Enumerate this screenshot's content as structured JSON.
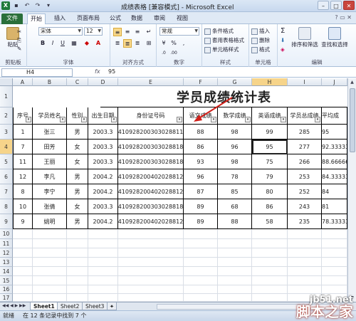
{
  "window": {
    "title": "成绩表格 [兼容模式] - Microsoft Excel"
  },
  "tabs": [
    "文件",
    "开始",
    "插入",
    "页面布局",
    "公式",
    "数据",
    "审阅",
    "视图"
  ],
  "ribbon": {
    "paste": "粘贴",
    "font_name": "宋体",
    "font_size": "12",
    "number_format": "常规",
    "bold": "B",
    "italic": "I",
    "underline": "U",
    "cond_format": "条件格式",
    "table_format": "套用表格格式",
    "cell_style": "单元格样式",
    "insert": "插入",
    "delete": "删除",
    "format": "格式",
    "sort_filter": "排序和筛选",
    "find_select": "查找和选择",
    "groups": {
      "clipboard": "剪贴板",
      "font": "字体",
      "align": "对齐方式",
      "number": "数字",
      "styles": "样式",
      "cells": "单元格",
      "editing": "编辑"
    }
  },
  "formula_bar": {
    "cell_ref": "H4",
    "fx": "fx",
    "value": "95"
  },
  "columns": [
    "A",
    "B",
    "C",
    "D",
    "E",
    "F",
    "G",
    "H",
    "I",
    "J"
  ],
  "rows": [
    "1",
    "2",
    "3",
    "4",
    "5",
    "6",
    "7",
    "8",
    "9",
    "10",
    "11",
    "12",
    "13",
    "14",
    "15",
    "16",
    "17"
  ],
  "sheet": {
    "title": "学员成绩统计表",
    "headers": [
      "序号",
      "学员姓名",
      "性别",
      "出生日期",
      "身份证号码",
      "语文成绩",
      "数学成绩",
      "英语成绩",
      "学员总成绩",
      "平均成"
    ],
    "data": [
      [
        "1",
        "张三",
        "男",
        "2003.3",
        "410928200303028811",
        "88",
        "98",
        "99",
        "285",
        "95"
      ],
      [
        "7",
        "田芳",
        "女",
        "2003.3",
        "410928200303028818",
        "86",
        "96",
        "95",
        "277",
        "92.33333"
      ],
      [
        "11",
        "王丽",
        "女",
        "2003.3",
        "410928200303028818",
        "93",
        "98",
        "75",
        "266",
        "88.66666"
      ],
      [
        "12",
        "李凡",
        "男",
        "2004.2",
        "410928200402028812",
        "96",
        "78",
        "79",
        "253",
        "84.33333"
      ],
      [
        "8",
        "李宁",
        "男",
        "2004.2",
        "410928200402028812",
        "87",
        "85",
        "80",
        "252",
        "84"
      ],
      [
        "10",
        "张倩",
        "女",
        "2003.3",
        "410928200303028818",
        "89",
        "68",
        "86",
        "243",
        "81"
      ],
      [
        "9",
        "姚明",
        "男",
        "2004.2",
        "410928200402028812",
        "89",
        "88",
        "58",
        "235",
        "78.33333"
      ]
    ]
  },
  "sheet_tabs": [
    "Sheet1",
    "Sheet2",
    "Sheet3"
  ],
  "status": {
    "ready": "就绪",
    "message": "在 12 条记录中找到 7 个"
  },
  "watermark": {
    "line1": "jb51.net",
    "line2": "脚本之家"
  }
}
